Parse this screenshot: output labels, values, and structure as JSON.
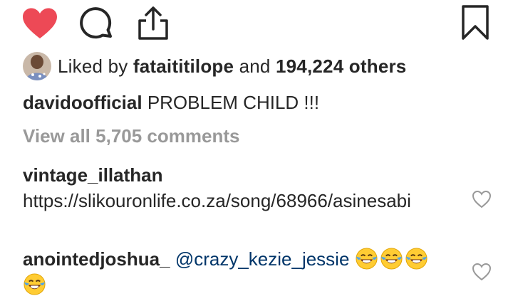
{
  "actions": {
    "like_icon": "heart-filled-icon",
    "comment_icon": "comment-bubble-icon",
    "share_icon": "share-upload-icon",
    "save_icon": "bookmark-icon",
    "like_color": "#ED4956"
  },
  "likes": {
    "prefix": "Liked by ",
    "first_user": "fataititilope",
    "connector": " and ",
    "others": "194,224 others"
  },
  "caption": {
    "username": "davidoofficial",
    "text": "PROBLEM CHILD !!!"
  },
  "view_all_comments": "View all 5,705 comments",
  "comments": [
    {
      "username": "vintage_illathan",
      "text": "https://slikouronlife.co.za/song/68966/asinesabi"
    },
    {
      "username": "anointedjoshua_",
      "mention": "@crazy_kezie_jessie",
      "emoji": "face-with-tears-of-joy"
    }
  ],
  "colors": {
    "text": "#262626",
    "muted": "#999999",
    "mention": "#003569"
  }
}
